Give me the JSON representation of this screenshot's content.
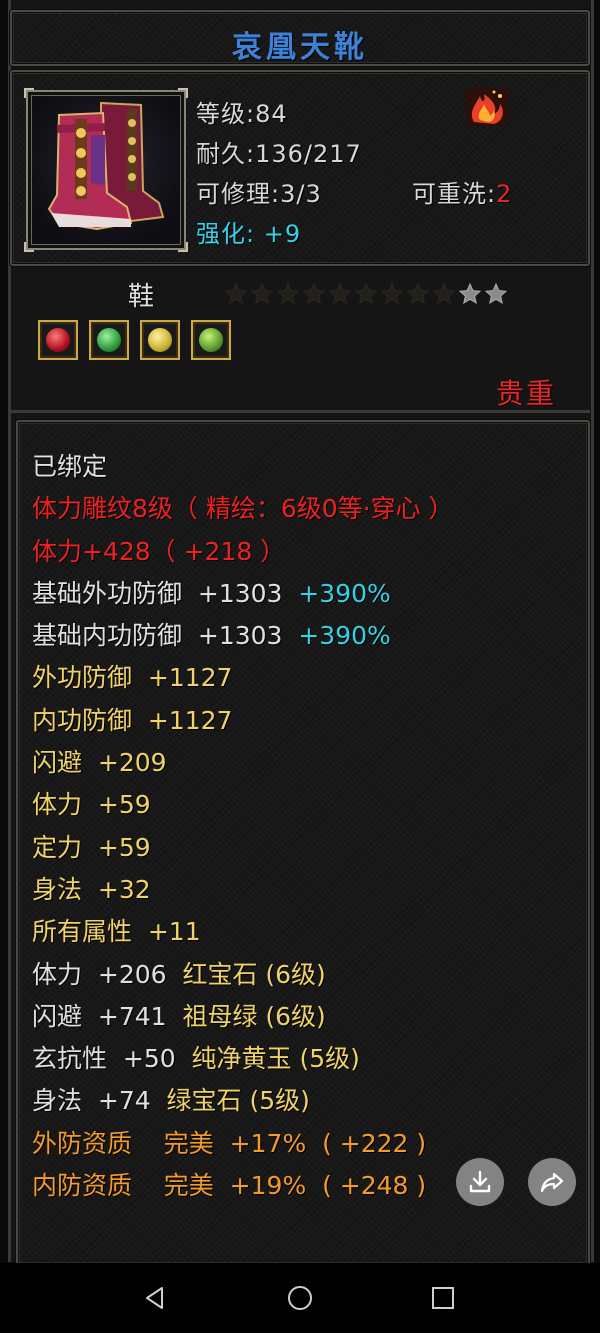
{
  "item": {
    "name": "哀凰天靴",
    "level": "等级:84",
    "durability": "耐久:136/217",
    "repair": "可修理:3/3",
    "rewash_label": "可重洗:",
    "rewash_value": "2",
    "enhance_label": "强化:",
    "enhance_value": "+9",
    "type": "鞋",
    "rarity": "贵重",
    "star_count_total": 11,
    "star_count_lit": 2
  },
  "attributes": [
    {
      "parts": [
        {
          "text": "已绑定",
          "color": "white"
        }
      ]
    },
    {
      "parts": [
        {
          "text": "体力雕纹8级（ 精绘：6级0等·穿心 ）",
          "color": "red"
        }
      ]
    },
    {
      "parts": [
        {
          "text": "体力+428（ +218 ）",
          "color": "red"
        }
      ]
    },
    {
      "parts": [
        {
          "text": "基础外功防御  +1303  ",
          "color": "white"
        },
        {
          "text": "+390%",
          "color": "cyan"
        }
      ]
    },
    {
      "parts": [
        {
          "text": "基础内功防御  +1303  ",
          "color": "white"
        },
        {
          "text": "+390%",
          "color": "cyan"
        }
      ]
    },
    {
      "parts": [
        {
          "text": "外功防御  +1127",
          "color": "yellow"
        }
      ]
    },
    {
      "parts": [
        {
          "text": "内功防御  +1127",
          "color": "yellow"
        }
      ]
    },
    {
      "parts": [
        {
          "text": "闪避  +209",
          "color": "yellow"
        }
      ]
    },
    {
      "parts": [
        {
          "text": "体力  +59",
          "color": "yellow"
        }
      ]
    },
    {
      "parts": [
        {
          "text": "定力  +59",
          "color": "yellow"
        }
      ]
    },
    {
      "parts": [
        {
          "text": "身法  +32",
          "color": "yellow"
        }
      ]
    },
    {
      "parts": [
        {
          "text": "所有属性  +11",
          "color": "yellow"
        }
      ]
    },
    {
      "parts": [
        {
          "text": "体力  +206  ",
          "color": "white"
        },
        {
          "text": "红宝石 (6级)",
          "color": "yellow"
        }
      ]
    },
    {
      "parts": [
        {
          "text": "闪避  +741  ",
          "color": "white"
        },
        {
          "text": "祖母绿 (6级)",
          "color": "yellow"
        }
      ]
    },
    {
      "parts": [
        {
          "text": "玄抗性  +50  ",
          "color": "white"
        },
        {
          "text": "纯净黄玉 (5级)",
          "color": "yellow"
        }
      ]
    },
    {
      "parts": [
        {
          "text": "身法  +74  ",
          "color": "white"
        },
        {
          "text": "绿宝石 (5级)",
          "color": "yellow"
        }
      ]
    },
    {
      "parts": [
        {
          "text": "外防资质    完美  +17%  ( +222 )",
          "color": "orange"
        }
      ]
    },
    {
      "parts": [
        {
          "text": "内防资质    完美  +19%  ( +248 )",
          "color": "orange"
        }
      ]
    }
  ],
  "colors": {
    "title": "#3d82d6",
    "white": "#e0e0e0",
    "red": "#ec2222",
    "yellow": "#f0d26a",
    "orange": "#f29a2e",
    "cyan": "#35d2e6"
  },
  "gems": [
    "ruby-gem-icon",
    "emerald-gem-icon",
    "topaz-gem-icon",
    "green-gem-icon"
  ],
  "actions": [
    "download-icon",
    "share-icon"
  ],
  "navbar": [
    "back-icon",
    "home-icon",
    "recent-apps-icon"
  ]
}
